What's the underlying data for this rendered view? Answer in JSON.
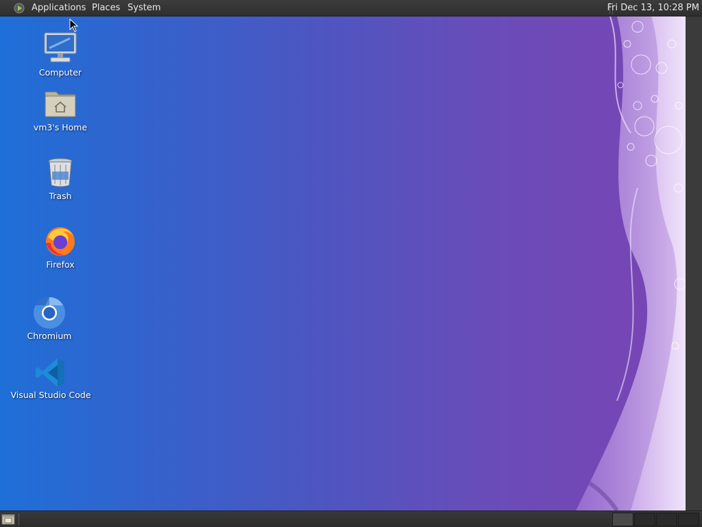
{
  "top_panel": {
    "menus": {
      "applications": "Applications",
      "places": "Places",
      "system": "System"
    },
    "clock": "Fri Dec 13, 10:28 PM",
    "logo_icon": "mate-logo-icon"
  },
  "desktop": {
    "icons": [
      {
        "label": "Computer",
        "icon": "computer-icon"
      },
      {
        "label": "vm3's Home",
        "icon": "home-folder-icon"
      },
      {
        "label": "Trash",
        "icon": "trash-icon"
      },
      {
        "label": "Firefox",
        "icon": "firefox-icon"
      },
      {
        "label": "Chromium",
        "icon": "chromium-icon"
      },
      {
        "label": "Visual Studio Code",
        "icon": "vscode-icon"
      }
    ],
    "colors": {
      "left": "#1f6fd8",
      "right": "#7a44b4"
    }
  },
  "bottom_panel": {
    "show_desktop_icon": "show-desktop-icon",
    "workspaces": 4,
    "active_workspace": 1
  }
}
